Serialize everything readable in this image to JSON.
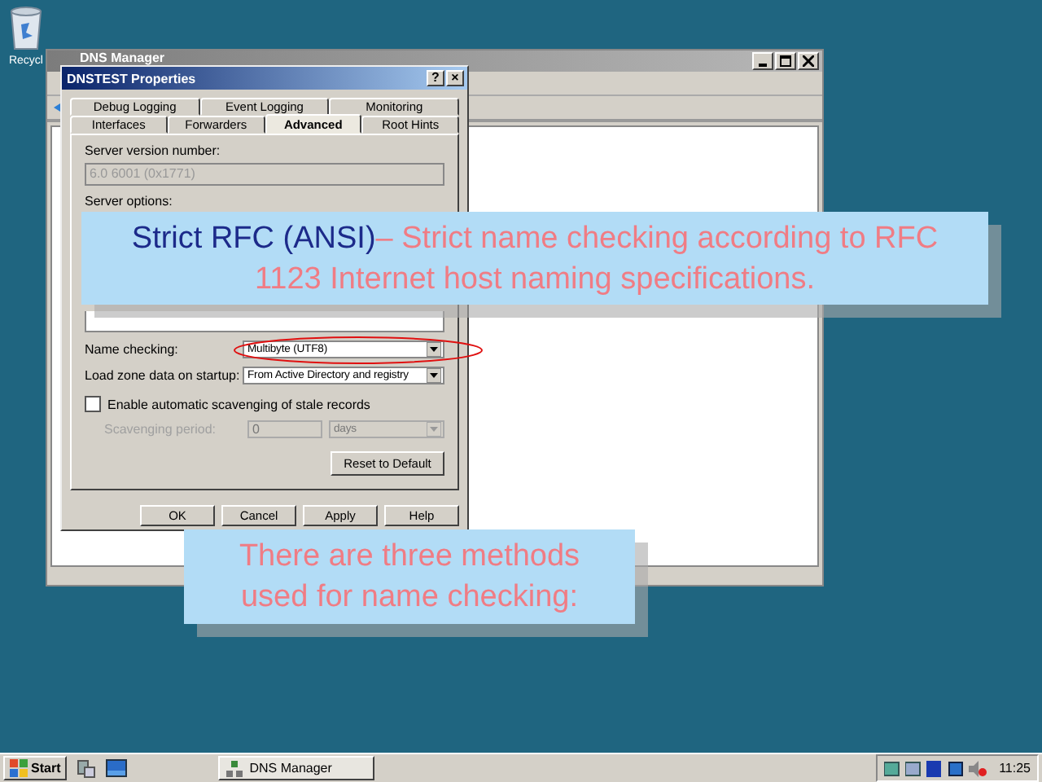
{
  "desktop_icons": [
    {
      "label": "Recycl"
    }
  ],
  "main_window": {
    "title": "DNS Manager"
  },
  "dialog": {
    "title": "DNSTEST Properties",
    "title_buttons": [
      "?",
      "×"
    ],
    "tab_rows": [
      [
        {
          "label": "Debug Logging",
          "selected": false
        },
        {
          "label": "Event Logging",
          "selected": false
        },
        {
          "label": "Monitoring",
          "selected": false
        }
      ],
      [
        {
          "label": "Interfaces",
          "selected": false
        },
        {
          "label": "Forwarders",
          "selected": false
        },
        {
          "label": "Advanced",
          "selected": true
        },
        {
          "label": "Root Hints",
          "selected": false
        }
      ]
    ],
    "server_version_label": "Server version number:",
    "server_version_value": "6.0 6001 (0x1771)",
    "server_options_label": "Server options:",
    "fields": [
      {
        "label": "Name checking:",
        "value": "Multibyte (UTF8)",
        "highlighted": true
      },
      {
        "label": "Load zone data on startup:",
        "value": "From Active Directory and registry",
        "highlighted": false
      }
    ],
    "scavenging": {
      "label": "Enable automatic scavenging of stale records",
      "checked": false
    },
    "scavenging_period": {
      "label": "Scavenging period:",
      "value": "0",
      "unit": "days",
      "disabled": true
    },
    "reset_button": "Reset to Default",
    "buttons": [
      "OK",
      "Cancel",
      "Apply",
      "Help"
    ]
  },
  "callouts": [
    {
      "heading": "Strict RFC (ANSI)",
      "text": "– Strict name checking according to RFC 1123 Internet host naming specifications."
    },
    {
      "text": "There are three methods used for name checking:"
    }
  ],
  "taskbar": {
    "start": "Start",
    "tasks": [
      {
        "label": "DNS Manager",
        "selected": false
      }
    ],
    "clock": "11:25"
  }
}
